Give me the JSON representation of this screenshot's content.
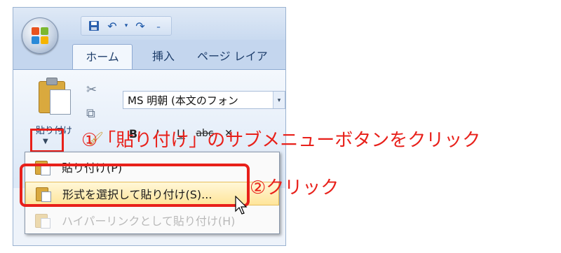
{
  "ribbon": {
    "tabs": [
      {
        "label": "ホーム",
        "active": true
      },
      {
        "label": "挿入",
        "active": false
      },
      {
        "label": "ページ レイア",
        "active": false
      }
    ],
    "clipboard": {
      "paste_label": "貼り付け"
    },
    "font": {
      "font_name": "MS 明朝 (本文のフォン",
      "bold": "B",
      "italic": "I",
      "underline": "U",
      "strike": "abc",
      "clear": "✕"
    }
  },
  "paste_menu": {
    "items": [
      {
        "label": "貼り付け(P)",
        "state": "normal"
      },
      {
        "label": "形式を選択して貼り付け(S)...",
        "state": "highlighted"
      },
      {
        "label": "ハイパーリンクとして貼り付け(H)",
        "state": "disabled"
      }
    ]
  },
  "annotations": {
    "step1": "①「貼り付け」のサブメニューボタンをクリック",
    "step2": "②クリック"
  },
  "colors": {
    "annotation": "#e8201a",
    "highlight": "#ffe59a"
  },
  "icons": [
    "office-button-icon",
    "save-icon",
    "undo-icon",
    "redo-icon",
    "qat-customize-icon",
    "paste-icon",
    "cut-icon",
    "copy-icon",
    "format-painter-icon",
    "mouse-cursor-icon"
  ]
}
